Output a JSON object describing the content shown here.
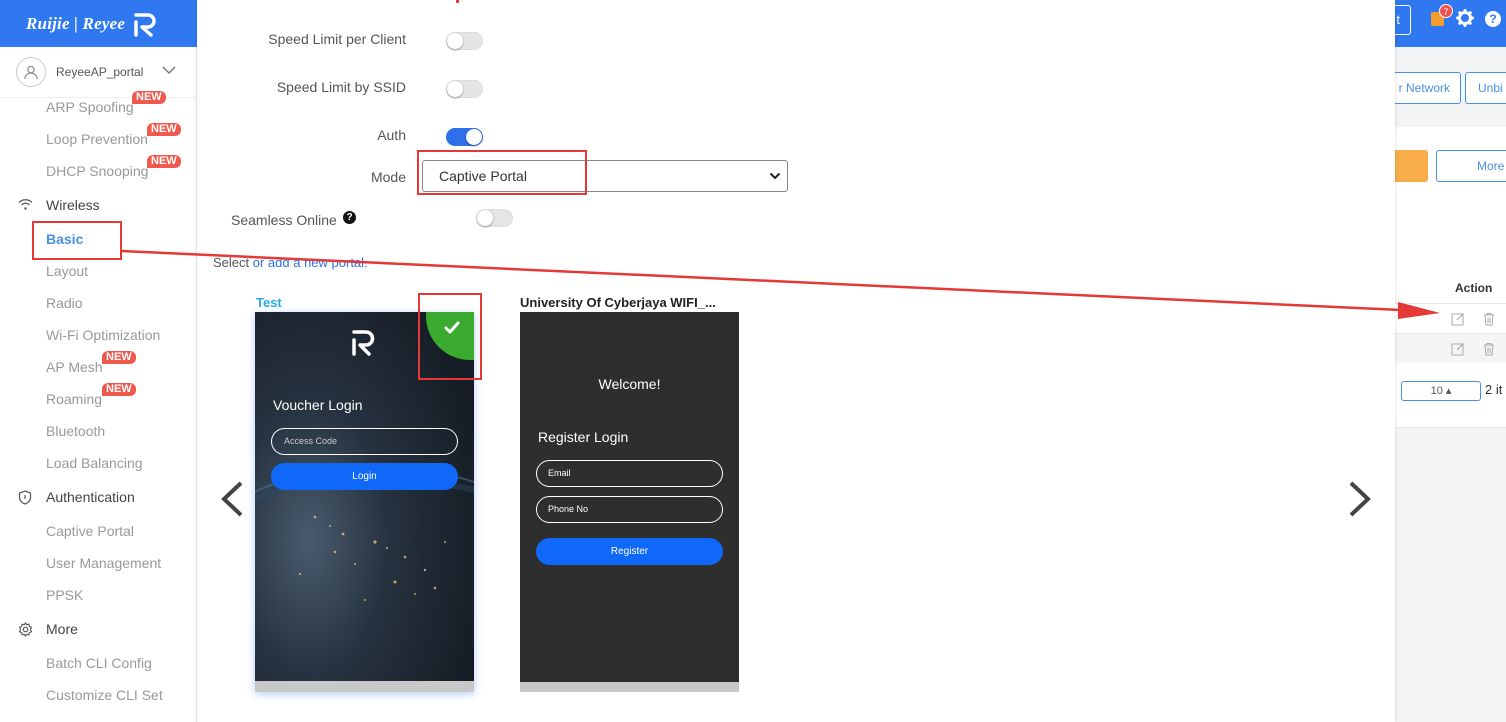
{
  "header": {
    "brand": "Ruijie | Reyee",
    "partial_button": "t",
    "notification_count": "7",
    "help_glyph": "?"
  },
  "sidebar": {
    "device": "ReyeeAP_portal",
    "items": [
      {
        "label": "ARP Spoofing",
        "badge": "NEW"
      },
      {
        "label": "Loop Prevention",
        "badge": "NEW"
      },
      {
        "label": "DHCP Snooping",
        "badge": "NEW"
      },
      {
        "label": "Wireless",
        "section": true,
        "icon": "wifi-icon"
      },
      {
        "label": "Basic",
        "active": true
      },
      {
        "label": "Layout"
      },
      {
        "label": "Radio"
      },
      {
        "label": "Wi-Fi Optimization"
      },
      {
        "label": "AP Mesh",
        "badge": "NEW"
      },
      {
        "label": "Roaming",
        "badge": "NEW"
      },
      {
        "label": "Bluetooth"
      },
      {
        "label": "Load Balancing"
      },
      {
        "label": "Authentication",
        "section": true,
        "icon": "shield-icon"
      },
      {
        "label": "Captive Portal"
      },
      {
        "label": "User Management"
      },
      {
        "label": "PPSK"
      },
      {
        "label": "More",
        "section": true,
        "icon": "gear-icon"
      },
      {
        "label": "Batch CLI Config"
      },
      {
        "label": "Customize CLI Set"
      }
    ]
  },
  "form": {
    "speed_limit_client_label": "Speed Limit per Client",
    "speed_limit_client_on": false,
    "speed_limit_ssid_label": "Speed Limit by SSID",
    "speed_limit_ssid_on": false,
    "auth_label": "Auth",
    "auth_on": true,
    "mode_label": "Mode",
    "mode_value": "Captive Portal",
    "seamless_label": "Seamless Online",
    "seamless_on": false,
    "help_glyph": "?",
    "portal_hint_prefix": "Select",
    "portal_hint_link": " or add a new portal."
  },
  "portals": [
    {
      "title": "Test",
      "selected": true,
      "heading": "Voucher Login",
      "input_placeholder": "Access Code",
      "button": "Login"
    },
    {
      "title": "University Of Cyberjaya WIFI_...",
      "selected": false,
      "welcome": "Welcome!",
      "heading": "Register Login",
      "input1": "Email",
      "input2": "Phone No",
      "button": "Register"
    }
  ],
  "background": {
    "network_button": "r Network",
    "unbind_button": "Unbi",
    "more_button": "More",
    "action_header": "Action",
    "page_size": "10 ▴",
    "items_text": "2 it"
  },
  "colors": {
    "primary": "#2f78f0",
    "annotation_red": "#e53935",
    "selected_green": "#3aab2e",
    "new_badge": "#ef5a4c"
  }
}
